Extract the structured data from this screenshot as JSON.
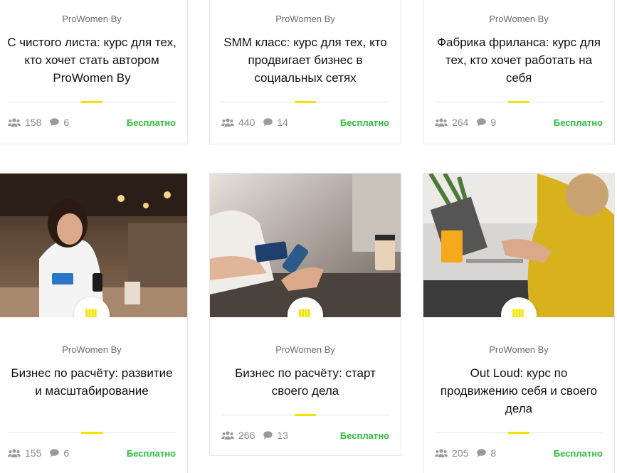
{
  "courses": [
    {
      "author": "ProWomen By",
      "title": "С чистого листа: курс для тех, кто хочет стать автором ProWomen By",
      "students": "158",
      "comments": "6",
      "price": "Бесплатно"
    },
    {
      "author": "ProWomen By",
      "title": "SMM класс: курс для тех, кто продвигает бизнес в социальных сетях",
      "students": "440",
      "comments": "14",
      "price": "Бесплатно"
    },
    {
      "author": "ProWomen By",
      "title": "Фабрика фриланса: курс для тех, кто хочет работать на себя",
      "students": "264",
      "comments": "9",
      "price": "Бесплатно"
    },
    {
      "author": "ProWomen By",
      "title": "Бизнес по расчёту: развитие и масштабирование",
      "students": "155",
      "comments": "6",
      "price": "Бесплатно"
    },
    {
      "author": "ProWomen By",
      "title": "Бизнес по расчёту: старт своего дела",
      "students": "266",
      "comments": "13",
      "price": "Бесплатно"
    },
    {
      "author": "ProWomen By",
      "title": "Out Loud: курс по продвижению себя и своего дела",
      "students": "205",
      "comments": "8",
      "price": "Бесплатно"
    }
  ],
  "avatar_text": "IIII.",
  "colors": {
    "accent_yellow": "#f2e400",
    "price_green": "#2bbd3c",
    "meta_gray": "#8a8a8a"
  },
  "icons": [
    "users-icon",
    "comment-icon"
  ]
}
